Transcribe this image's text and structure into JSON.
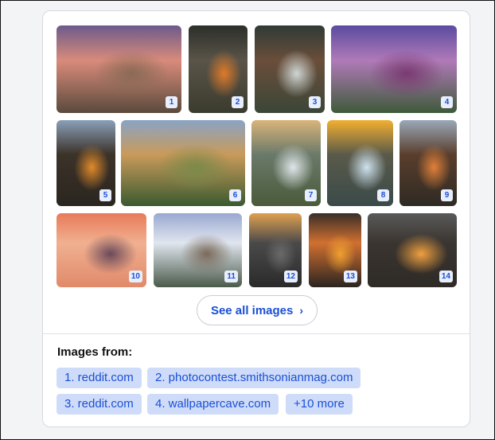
{
  "images": [
    {
      "badge": "1",
      "colors": [
        "#6c5a8a",
        "#d98b7b",
        "#8a6a55",
        "#5a4a3c"
      ]
    },
    {
      "badge": "2",
      "colors": [
        "#2b2f2a",
        "#5a5448",
        "#e07a2a",
        "#3a3b2e"
      ]
    },
    {
      "badge": "3",
      "colors": [
        "#2f3b36",
        "#6a4e3a",
        "#cfd6d4",
        "#3b4638"
      ]
    },
    {
      "badge": "4",
      "colors": [
        "#5a4ba0",
        "#b07ab8",
        "#7a3a72",
        "#3e5a3a"
      ]
    },
    {
      "badge": "5",
      "colors": [
        "#8aa0b8",
        "#3c3228",
        "#e08a2a",
        "#2a2620"
      ]
    },
    {
      "badge": "6",
      "colors": [
        "#8aa4c4",
        "#c99a5a",
        "#7a8a4a",
        "#3a5a30"
      ]
    },
    {
      "badge": "7",
      "colors": [
        "#d9b47a",
        "#6a7a6a",
        "#dfe6ea",
        "#4a5a3a"
      ]
    },
    {
      "badge": "8",
      "colors": [
        "#f2b030",
        "#5a5a4a",
        "#cfe2ee",
        "#3a4a4a"
      ]
    },
    {
      "badge": "9",
      "colors": [
        "#9aa8b8",
        "#5a3e2c",
        "#e0803a",
        "#2e2a24"
      ]
    },
    {
      "badge": "10",
      "colors": [
        "#e87a5a",
        "#f0b090",
        "#6a4a5a",
        "#e08a6a"
      ]
    },
    {
      "badge": "11",
      "colors": [
        "#9aa8d0",
        "#e0e6ee",
        "#7a6a5a",
        "#4a5a4a"
      ]
    },
    {
      "badge": "12",
      "colors": [
        "#e0a050",
        "#4a4a4a",
        "#6a6a6a",
        "#2a2a2a"
      ]
    },
    {
      "badge": "13",
      "colors": [
        "#3a2e28",
        "#d07030",
        "#f0a030",
        "#2a2420"
      ]
    },
    {
      "badge": "14",
      "colors": [
        "#5a5a5a",
        "#3a3530",
        "#f0a040",
        "#2e2a26"
      ]
    }
  ],
  "see_all": {
    "label": "See all images",
    "chevron": "›"
  },
  "sources": {
    "title": "Images from:",
    "chips": [
      "1. reddit.com",
      "2. photocontest.smithsonianmag.com",
      "3. reddit.com",
      "4. wallpapercave.com",
      "+10 more"
    ]
  }
}
